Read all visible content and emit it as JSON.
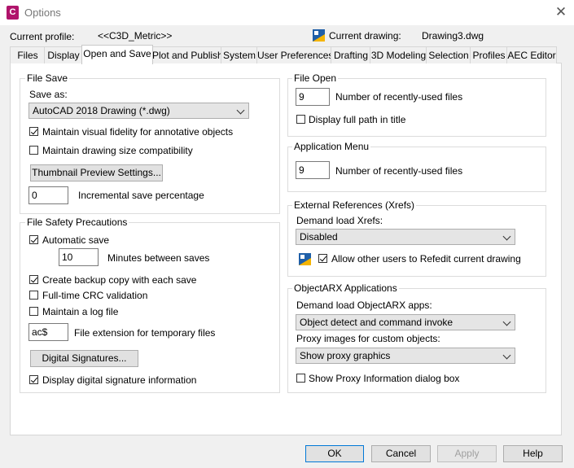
{
  "window": {
    "title": "Options",
    "app_icon_letter": "C",
    "brand_color": "#b0136b"
  },
  "header": {
    "profile_label": "Current profile:",
    "profile_value": "<<C3D_Metric>>",
    "drawing_label": "Current drawing:",
    "drawing_value": "Drawing3.dwg"
  },
  "tabs": [
    {
      "label": "Files"
    },
    {
      "label": "Display"
    },
    {
      "label": "Open and Save",
      "active": true
    },
    {
      "label": "Plot and Publish"
    },
    {
      "label": "System"
    },
    {
      "label": "User Preferences"
    },
    {
      "label": "Drafting"
    },
    {
      "label": "3D Modeling"
    },
    {
      "label": "Selection"
    },
    {
      "label": "Profiles"
    },
    {
      "label": "AEC Editor"
    }
  ],
  "file_save": {
    "title": "File Save",
    "save_as_label": "Save as:",
    "save_as_value": "AutoCAD 2018 Drawing (*.dwg)",
    "maintain_fidelity": {
      "label": "Maintain visual fidelity for annotative objects",
      "checked": true
    },
    "maintain_size": {
      "label": "Maintain drawing size compatibility",
      "checked": false
    },
    "thumbnail_button": "Thumbnail Preview Settings...",
    "incremental_value": "0",
    "incremental_label": "Incremental save percentage"
  },
  "file_safety": {
    "title": "File Safety Precautions",
    "automatic_save": {
      "label": "Automatic save",
      "checked": true
    },
    "minutes_value": "10",
    "minutes_label": "Minutes between saves",
    "backup": {
      "label": "Create backup copy with each save",
      "checked": true
    },
    "crc": {
      "label": "Full-time CRC validation",
      "checked": false
    },
    "log_file": {
      "label": "Maintain a log file",
      "checked": false
    },
    "ext_value": "ac$",
    "ext_label": "File extension for temporary files",
    "digital_signatures_button": "Digital Signatures...",
    "display_signature": {
      "label": "Display digital signature information",
      "checked": true
    }
  },
  "file_open": {
    "title": "File Open",
    "recent_value": "9",
    "recent_label": "Number of recently-used files",
    "full_path": {
      "label": "Display full path in title",
      "checked": false
    }
  },
  "app_menu": {
    "title": "Application Menu",
    "recent_value": "9",
    "recent_label": "Number of recently-used files"
  },
  "xrefs": {
    "title": "External References (Xrefs)",
    "demand_label": "Demand load Xrefs:",
    "demand_value": "Disabled",
    "allow_refedit": {
      "label": "Allow other users to Refedit current drawing",
      "checked": true
    }
  },
  "objectarx": {
    "title": "ObjectARX Applications",
    "demand_label": "Demand load ObjectARX apps:",
    "demand_value": "Object detect and command invoke",
    "proxy_label": "Proxy images for custom objects:",
    "proxy_value": "Show proxy graphics",
    "show_proxy_info": {
      "label": "Show Proxy Information dialog box",
      "checked": false
    }
  },
  "footer": {
    "ok": "OK",
    "cancel": "Cancel",
    "apply": "Apply",
    "help": "Help"
  }
}
